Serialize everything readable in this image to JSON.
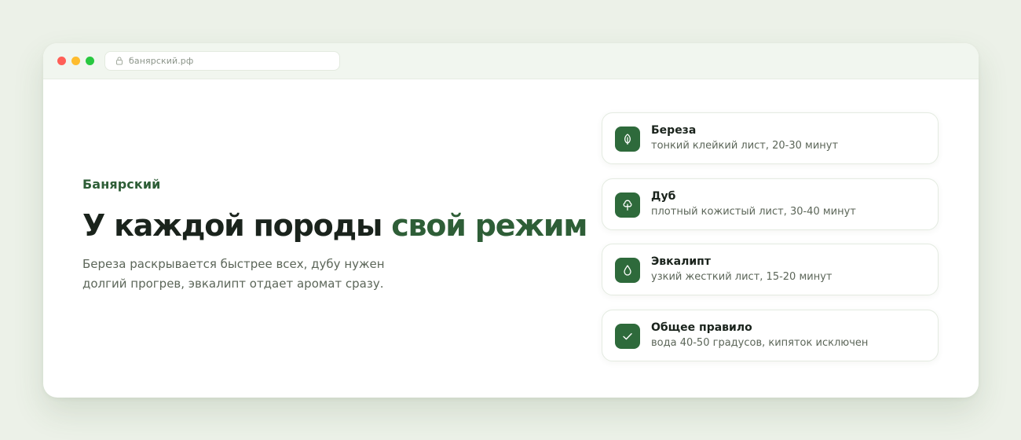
{
  "browser": {
    "url": "банярский.рф",
    "lock_icon": "lock-icon"
  },
  "hero": {
    "brand": "Банярский",
    "headline_main": "У каждой породы ",
    "headline_accent": "свой режим",
    "description": "Береза раскрывается быстрее всех, дубу нужен долгий прогрев, эвкалипт отдает аромат сразу."
  },
  "cards": [
    {
      "icon": "leaf-icon",
      "title": "Береза",
      "subtitle": "тонкий клейкий лист, 20-30 минут"
    },
    {
      "icon": "tree-icon",
      "title": "Дуб",
      "subtitle": "плотный кожистый лист, 30-40 минут"
    },
    {
      "icon": "droplet-icon",
      "title": "Эвкалипт",
      "subtitle": "узкий жесткий лист, 15-20 минут"
    },
    {
      "icon": "check-icon",
      "title": "Общее правило",
      "subtitle": "вода 40-50 градусов, кипяток исключен"
    }
  ],
  "colors": {
    "accent": "#2e5e37",
    "icon_bg": "#2e6a3b",
    "page_bg": "#ecf1e8"
  }
}
